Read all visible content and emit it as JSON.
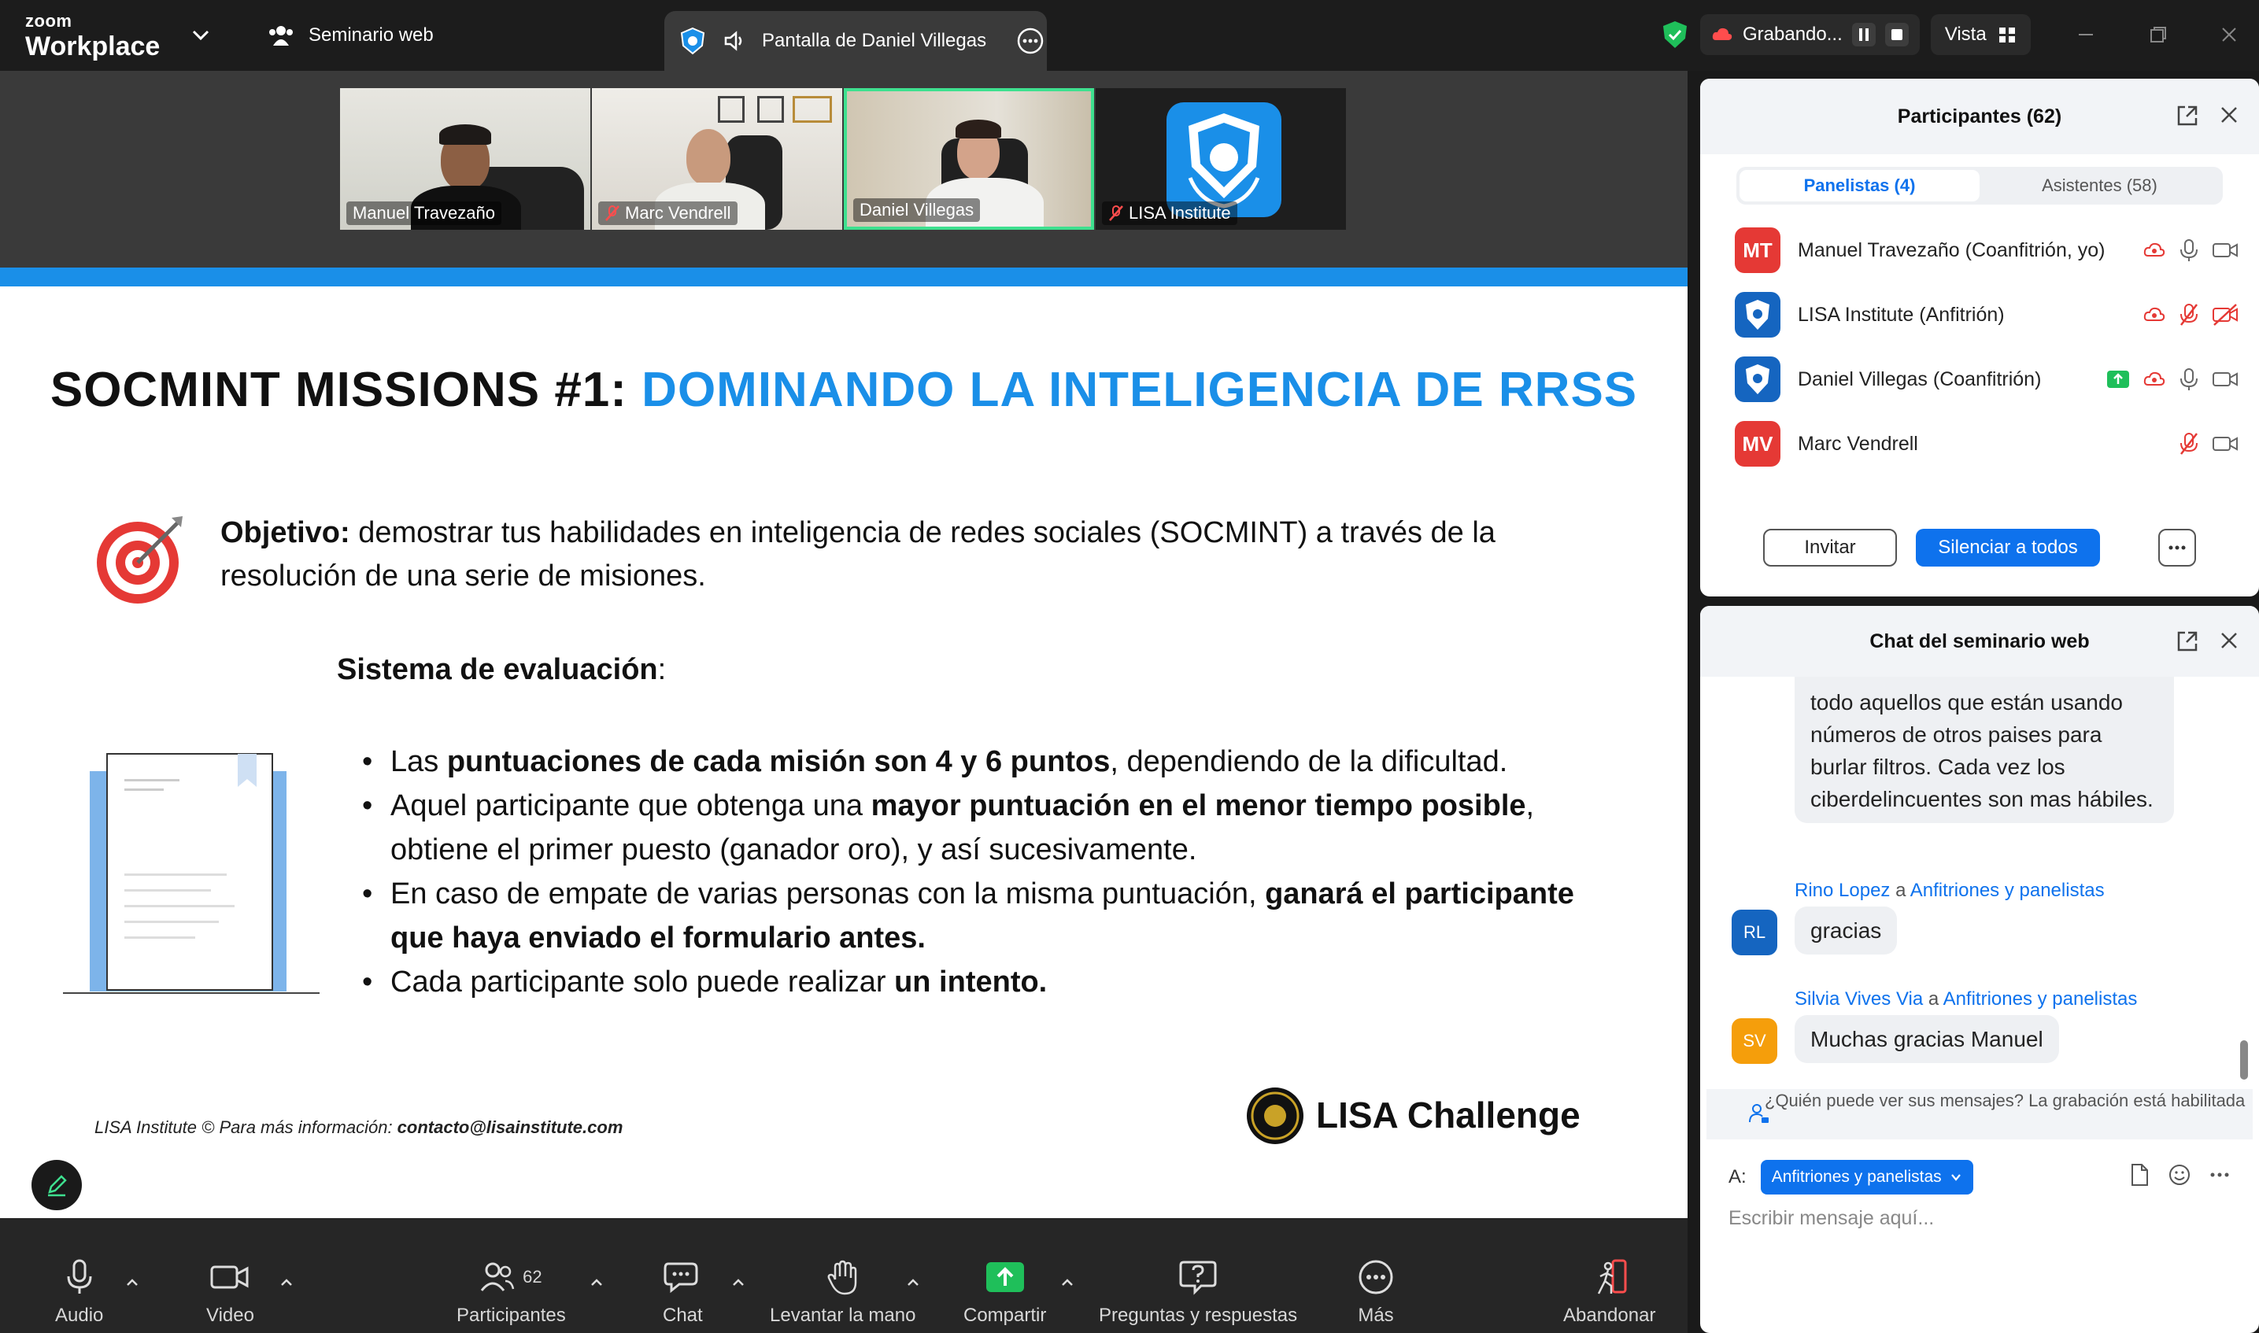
{
  "topbar": {
    "brand_top": "zoom",
    "brand_bottom": "Workplace",
    "webinar_label": "Seminario web",
    "share_label": "Pantalla de Daniel Villegas",
    "recording_label": "Grabando...",
    "view_label": "Vista"
  },
  "videos": [
    {
      "name": "Manuel Travezaño",
      "muted": false
    },
    {
      "name": "Marc Vendrell",
      "muted": true
    },
    {
      "name": "Daniel Villegas",
      "muted": false,
      "active": true
    },
    {
      "name": "LISA Institute",
      "muted": true
    }
  ],
  "slide": {
    "title_main": "SOCMINT MISSIONS #1: ",
    "title_highlight": "DOMINANDO LA INTELIGENCIA DE RRSS",
    "objective_label": "Objetivo:",
    "objective_text": " demostrar tus habilidades en inteligencia de redes sociales (SOCMINT) a través de la resolución de una serie de misiones.",
    "evaluation_heading": "Sistema de evaluación",
    "evaluation_colon": ":",
    "bullets": [
      {
        "pre": "Las ",
        "bold": "puntuaciones de cada misión son 4 y 6 puntos",
        "post": ", dependiendo de la dificultad."
      },
      {
        "pre": "Aquel participante que obtenga una ",
        "bold": "mayor puntuación en el menor tiempo posible",
        "post": ", obtiene el primer puesto (ganador oro), y así sucesivamente."
      },
      {
        "pre": "En caso de empate de varias personas con la misma puntuación, ",
        "bold": "ganará el participante que haya enviado el formulario antes.",
        "post": ""
      },
      {
        "pre": "Cada participante solo puede realizar ",
        "bold": "un intento.",
        "post": ""
      }
    ],
    "footer_left": "LISA Institute ©  Para más información: ",
    "footer_email": "contacto@lisainstitute.com",
    "logo_text": "LISA Challenge"
  },
  "toolbar": {
    "audio": "Audio",
    "video": "Video",
    "participants": "Participantes",
    "participants_count": "62",
    "chat": "Chat",
    "raise_hand": "Levantar la mano",
    "share": "Compartir",
    "qa": "Preguntas y respuestas",
    "more": "Más",
    "leave": "Abandonar"
  },
  "participants_panel": {
    "title": "Participantes (62)",
    "tab_panelists": "Panelistas (4)",
    "tab_attendees": "Asistentes (58)",
    "rows": [
      {
        "initials": "MT",
        "name": "Manuel Travezaño (Coanfitrión, yo)",
        "color": "#e53935"
      },
      {
        "initials": "",
        "name": "LISA Institute (Anfitrión)",
        "color": "#1565c0"
      },
      {
        "initials": "",
        "name": "Daniel Villegas (Coanfitrión)",
        "color": "#1565c0"
      },
      {
        "initials": "MV",
        "name": "Marc Vendrell",
        "color": "#e53935"
      }
    ],
    "invite": "Invitar",
    "mute_all": "Silenciar a todos"
  },
  "chat_panel": {
    "title": "Chat del seminario web",
    "msg1_text": "todo aquellos que están usando números de otros paises para burlar filtros. Cada vez los ciberdelincuentes son mas hábiles.",
    "msg2_sender": "Rino Lopez",
    "msg2_to": "Anfitriones y panelistas",
    "msg2_initials": "RL",
    "msg2_text": "gracias",
    "msg3_sender": "Silvia Vives Via",
    "msg3_to": "Anfitriones y panelistas",
    "msg3_initials": "SV",
    "msg3_text": "Muchas gracias Manuel",
    "connector": " a ",
    "privacy": "¿Quién puede ver sus mensajes? La grabación está habilitada",
    "to_label": "A:",
    "to_value": "Anfitriones y panelistas",
    "placeholder": "Escribir mensaje aquí..."
  }
}
